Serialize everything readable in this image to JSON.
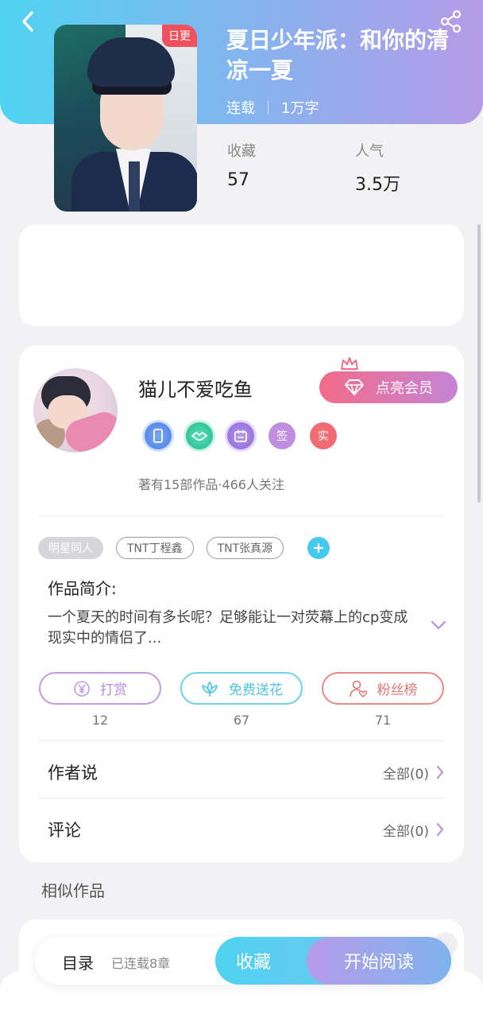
{
  "header": {
    "back_icon": "chevron-left-icon",
    "share_icon": "share-icon"
  },
  "book": {
    "badge": "日更",
    "title": "夏日少年派：和你的清凉一夏",
    "status": "连载",
    "word_count": "1万字",
    "stats": [
      {
        "label": "收藏",
        "value": "57"
      },
      {
        "label": "人气",
        "value": "3.5万"
      }
    ]
  },
  "author": {
    "name": "猫儿不爱吃鱼",
    "vip_button": "点亮会员",
    "medals": [
      "phone-medal-icon",
      "handshake-medal-icon",
      "calendar-medal-icon",
      "签",
      "实"
    ],
    "summary": "著有15部作品·466人关注"
  },
  "tags": [
    "明星同人",
    "TNT丁程鑫",
    "TNT张真源"
  ],
  "intro": {
    "label": "作品简介:",
    "text": "一个夏天的时间有多长呢？足够能让一对荧幕上的cp变成现实中的情侣了..."
  },
  "actions": [
    {
      "label": "打赏",
      "count": "12"
    },
    {
      "label": "免费送花",
      "count": "67"
    },
    {
      "label": "粉丝榜",
      "count": "71"
    }
  ],
  "sections": [
    {
      "title": "作者说",
      "right": "全部(0)"
    },
    {
      "title": "评论",
      "right": "全部(0)"
    }
  ],
  "similar_label": "相似作品",
  "bottom_bar": {
    "toc": "目录",
    "status": "已连载8章",
    "favorite": "收藏",
    "read": "开始阅读"
  },
  "colors": {
    "accent_cyan": "#4fd3f0",
    "accent_purple": "#b49be8",
    "vip_pink": "#f36b88"
  }
}
